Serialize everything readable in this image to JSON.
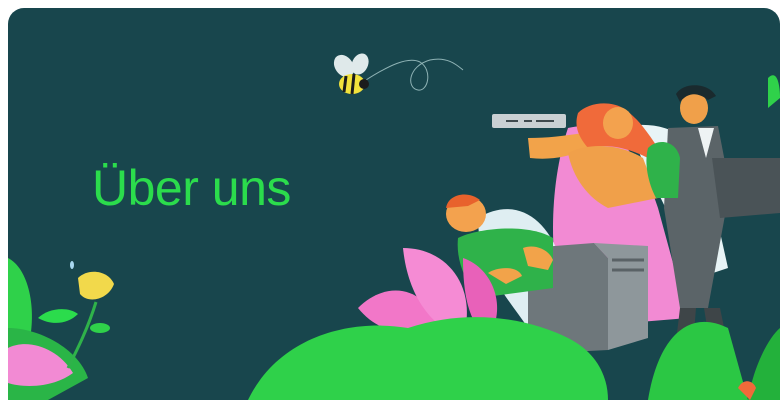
{
  "banner": {
    "heading": "Über uns",
    "colors": {
      "background": "#18464d",
      "heading": "#2bdc4c",
      "leaf_green": "#2fd14a",
      "petal_pink": "#f277c8",
      "skin_orange": "#f08a3a",
      "suit_gray": "#5b6468",
      "server_gray": "#6e777b"
    },
    "illustration": {
      "elements": [
        "bee-icon",
        "woman-holding-server",
        "man-with-suitcase",
        "sleeping-man",
        "server-tower",
        "pink-flower",
        "yellow-tulip",
        "green-leaves"
      ]
    }
  }
}
